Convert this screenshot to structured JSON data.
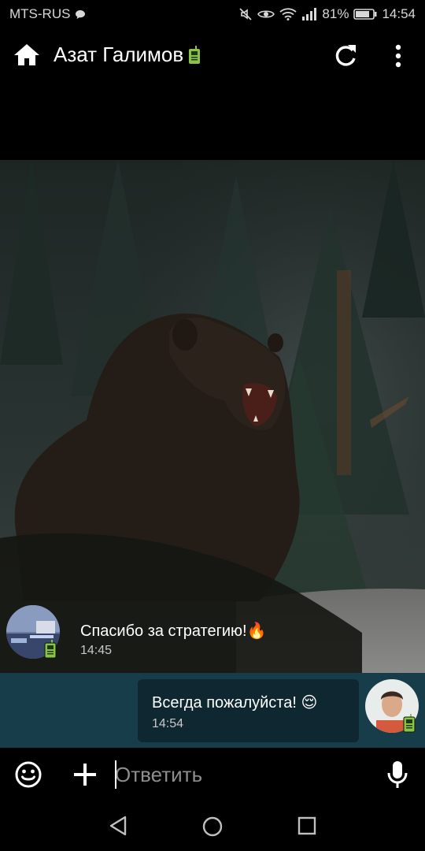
{
  "status_bar": {
    "carrier": "MTS-RUS",
    "battery": "81%",
    "time": "14:54"
  },
  "header": {
    "title": "Азат Галимов"
  },
  "messages": {
    "incoming": {
      "text": "Спасибо за стратегию!🔥",
      "time": "14:45"
    },
    "outgoing": {
      "text": "Всегда пожалуйста! 😌",
      "time": "14:54"
    }
  },
  "input": {
    "placeholder": "Ответить"
  },
  "icons": {
    "home": "home-icon",
    "refresh": "refresh-icon",
    "menu": "more-vert-icon",
    "emoji": "emoji-icon",
    "attach": "plus-icon",
    "mic": "mic-icon",
    "badge": "walkie-talkie-icon"
  },
  "colors": {
    "outgoing_band": "#183d4a",
    "outgoing_bubble": "#0f2730",
    "badge_green": "#8bc34a"
  }
}
